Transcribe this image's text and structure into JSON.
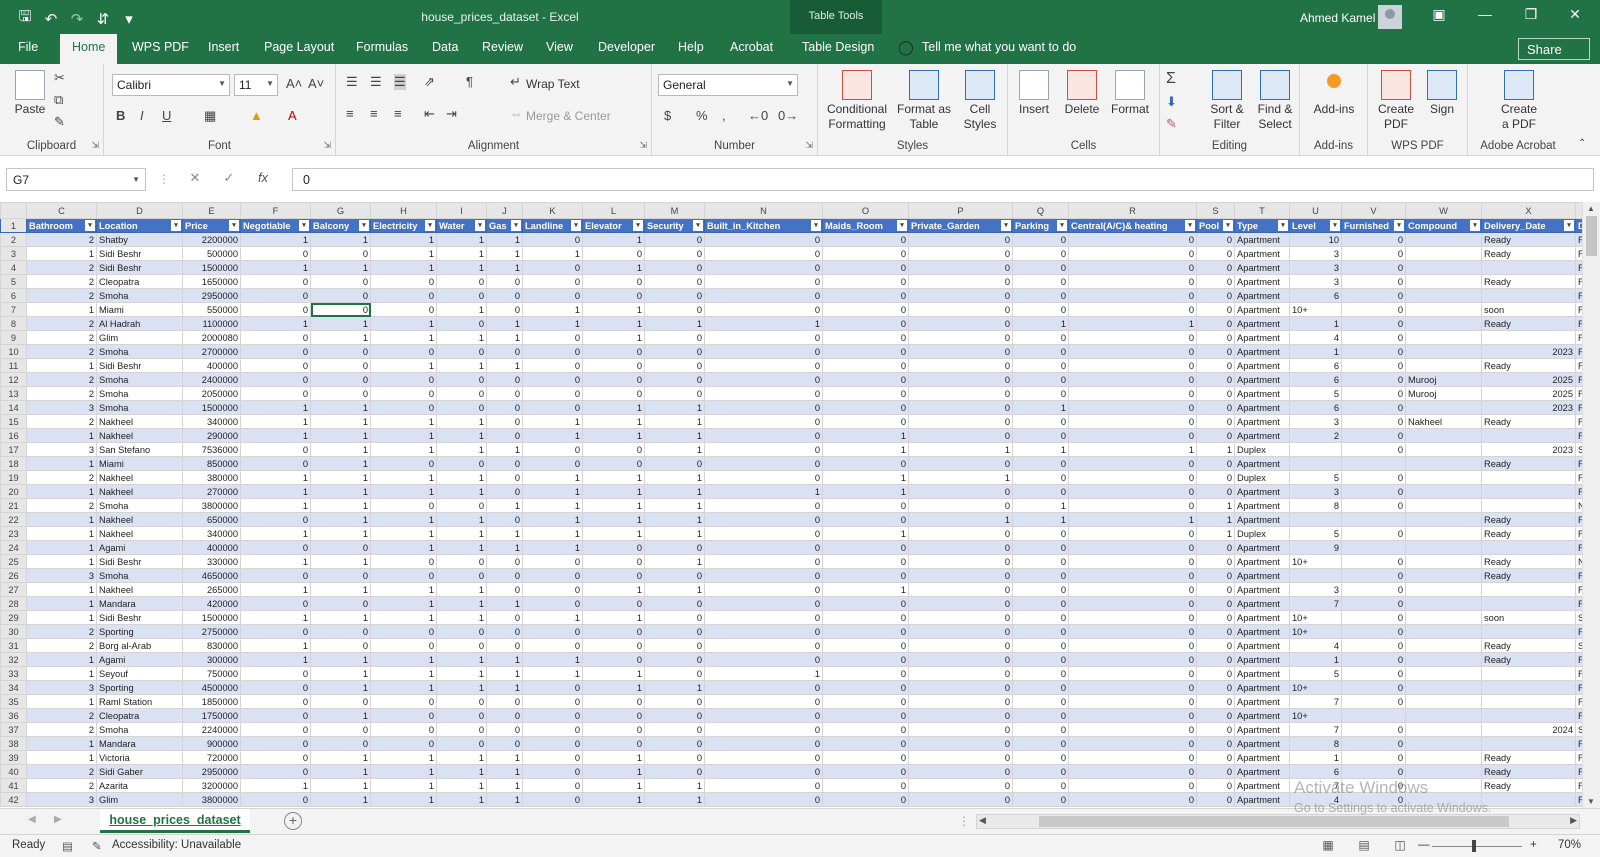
{
  "titlebar": {
    "doc_title": "house_prices_dataset  -  Excel",
    "context_group": "Table Tools",
    "user_name": "Ahmed Kamel",
    "qat_icons": [
      "save-icon",
      "undo-icon",
      "redo-icon",
      "sort-icon",
      "customize-icon"
    ]
  },
  "tabs": [
    "File",
    "Home",
    "WPS PDF",
    "Insert",
    "Page Layout",
    "Formulas",
    "Data",
    "Review",
    "View",
    "Developer",
    "Help",
    "Acrobat",
    "Table Design"
  ],
  "active_tab": "Home",
  "tell_me": "Tell me what you want to do",
  "share": "Share",
  "ribbon": {
    "clipboard": {
      "paste": "Paste",
      "label": "Clipboard"
    },
    "font": {
      "name": "Calibri",
      "size": "11",
      "bold": "B",
      "italic": "I",
      "underline": "U",
      "label": "Font"
    },
    "alignment": {
      "wrap_text": "Wrap Text",
      "merge_center": "Merge & Center",
      "label": "Alignment"
    },
    "number": {
      "format": "General",
      "label": "Number"
    },
    "styles": {
      "conditional": "Conditional",
      "conditional2": "Formatting",
      "format_as": "Format as",
      "format_as2": "Table",
      "cell": "Cell",
      "cell2": "Styles",
      "label": "Styles"
    },
    "cells": {
      "insert": "Insert",
      "delete": "Delete",
      "format": "Format",
      "label": "Cells"
    },
    "editing": {
      "sort": "Sort &",
      "sort2": "Filter",
      "find": "Find &",
      "find2": "Select",
      "label": "Editing"
    },
    "addins": {
      "addins": "Add-ins",
      "label": "Add-ins"
    },
    "wps": {
      "create": "Create",
      "create2": "PDF",
      "sign": "Sign",
      "label": "WPS PDF"
    },
    "acrobat": {
      "create": "Create",
      "create2": "a PDF",
      "label": "Adobe Acrobat"
    }
  },
  "formula_bar": {
    "name_box": "G7",
    "value": "0"
  },
  "columns": {
    "letters": [
      "C",
      "D",
      "E",
      "F",
      "G",
      "H",
      "I",
      "J",
      "K",
      "L",
      "M",
      "N",
      "O",
      "P",
      "Q",
      "R",
      "S",
      "T",
      "U",
      "V",
      "W",
      "X",
      "Y"
    ],
    "headers": [
      "Bathroom",
      "Location",
      "Price",
      "Negotiable",
      "Balcony",
      "Electricity",
      "Water",
      "Gas",
      "Landline",
      "Elevator",
      "Security",
      "Built_in_Kitchen",
      "Maids_Room",
      "Private_Garden",
      "Parking",
      "Central(A/C)& heating",
      "Pool",
      "Type",
      "Level",
      "Furnished",
      "Compound",
      "Delivery_Date",
      "Deli"
    ]
  },
  "rows": [
    [
      "2",
      "2",
      "Shatby",
      "2200000",
      "1",
      "1",
      "1",
      "1",
      "1",
      "0",
      "1",
      "0",
      "0",
      "0",
      "0",
      "0",
      "0",
      "0",
      "Apartment",
      "10",
      "0",
      "",
      "Ready",
      "Fini"
    ],
    [
      "3",
      "1",
      "Sidi Beshr",
      "500000",
      "0",
      "0",
      "1",
      "1",
      "1",
      "1",
      "0",
      "0",
      "0",
      "0",
      "0",
      "0",
      "0",
      "0",
      "Apartment",
      "3",
      "0",
      "",
      "Ready",
      "Fini"
    ],
    [
      "4",
      "2",
      "Sidi Beshr",
      "1500000",
      "1",
      "1",
      "1",
      "1",
      "1",
      "0",
      "1",
      "0",
      "0",
      "0",
      "0",
      "0",
      "0",
      "0",
      "Apartment",
      "3",
      "0",
      "",
      "",
      "Fini"
    ],
    [
      "5",
      "2",
      "Cleopatra",
      "1650000",
      "0",
      "0",
      "0",
      "0",
      "0",
      "0",
      "0",
      "0",
      "0",
      "0",
      "0",
      "0",
      "0",
      "0",
      "Apartment",
      "3",
      "0",
      "",
      "Ready",
      "Fini"
    ],
    [
      "6",
      "2",
      "Smoha",
      "2950000",
      "0",
      "0",
      "0",
      "0",
      "0",
      "0",
      "0",
      "0",
      "0",
      "0",
      "0",
      "0",
      "0",
      "0",
      "Apartment",
      "6",
      "0",
      "",
      "",
      "Fini"
    ],
    [
      "7",
      "1",
      "Miami",
      "550000",
      "0",
      "0",
      "0",
      "1",
      "0",
      "1",
      "1",
      "0",
      "0",
      "0",
      "0",
      "0",
      "0",
      "0",
      "Apartment",
      "10+",
      "0",
      "",
      "soon",
      "Fini"
    ],
    [
      "8",
      "2",
      "Al Hadrah",
      "1100000",
      "1",
      "1",
      "1",
      "0",
      "1",
      "1",
      "1",
      "1",
      "1",
      "0",
      "0",
      "1",
      "1",
      "0",
      "Apartment",
      "1",
      "0",
      "",
      "Ready",
      "Fini"
    ],
    [
      "9",
      "2",
      "Glim",
      "2000080",
      "0",
      "1",
      "1",
      "1",
      "1",
      "0",
      "1",
      "0",
      "0",
      "0",
      "0",
      "0",
      "0",
      "0",
      "Apartment",
      "4",
      "0",
      "",
      "",
      "Fini"
    ],
    [
      "10",
      "2",
      "Smoha",
      "2700000",
      "0",
      "0",
      "0",
      "0",
      "0",
      "0",
      "0",
      "0",
      "0",
      "0",
      "0",
      "0",
      "0",
      "0",
      "Apartment",
      "1",
      "0",
      "",
      "2023",
      "Fini"
    ],
    [
      "11",
      "1",
      "Sidi Beshr",
      "400000",
      "0",
      "0",
      "1",
      "1",
      "1",
      "0",
      "0",
      "0",
      "0",
      "0",
      "0",
      "0",
      "0",
      "0",
      "Apartment",
      "6",
      "0",
      "",
      "Ready",
      "Fini"
    ],
    [
      "12",
      "2",
      "Smoha",
      "2400000",
      "0",
      "0",
      "0",
      "0",
      "0",
      "0",
      "0",
      "0",
      "0",
      "0",
      "0",
      "0",
      "0",
      "0",
      "Apartment",
      "6",
      "0",
      "Murooj",
      "2025",
      "Fini"
    ],
    [
      "13",
      "2",
      "Smoha",
      "2050000",
      "0",
      "0",
      "0",
      "0",
      "0",
      "0",
      "0",
      "0",
      "0",
      "0",
      "0",
      "0",
      "0",
      "0",
      "Apartment",
      "5",
      "0",
      "Murooj",
      "2025",
      "Fini"
    ],
    [
      "14",
      "3",
      "Smoha",
      "1500000",
      "1",
      "1",
      "0",
      "0",
      "0",
      "0",
      "1",
      "1",
      "0",
      "0",
      "0",
      "1",
      "0",
      "0",
      "Apartment",
      "6",
      "0",
      "",
      "2023",
      "Fini"
    ],
    [
      "15",
      "2",
      "Nakheel",
      "340000",
      "1",
      "1",
      "1",
      "1",
      "0",
      "1",
      "1",
      "1",
      "0",
      "0",
      "0",
      "0",
      "0",
      "0",
      "Apartment",
      "3",
      "0",
      "Nakheel",
      "Ready",
      "Fini"
    ],
    [
      "16",
      "1",
      "Nakheel",
      "290000",
      "1",
      "1",
      "1",
      "1",
      "0",
      "1",
      "1",
      "1",
      "0",
      "1",
      "0",
      "0",
      "0",
      "0",
      "Apartment",
      "2",
      "0",
      "",
      "",
      "Fini"
    ],
    [
      "17",
      "3",
      "San Stefano",
      "7536000",
      "0",
      "1",
      "1",
      "1",
      "1",
      "0",
      "0",
      "1",
      "0",
      "1",
      "1",
      "1",
      "1",
      "1",
      "Duplex",
      "",
      "0",
      "",
      "2023",
      "Ser"
    ],
    [
      "18",
      "1",
      "Miami",
      "850000",
      "0",
      "1",
      "0",
      "0",
      "0",
      "0",
      "0",
      "0",
      "0",
      "0",
      "0",
      "0",
      "0",
      "0",
      "Apartment",
      "",
      "",
      "",
      "Ready",
      "Fini"
    ],
    [
      "19",
      "2",
      "Nakheel",
      "380000",
      "1",
      "1",
      "1",
      "1",
      "0",
      "1",
      "1",
      "1",
      "0",
      "1",
      "1",
      "0",
      "0",
      "0",
      "Duplex",
      "5",
      "0",
      "",
      "",
      "Fini"
    ],
    [
      "20",
      "1",
      "Nakheel",
      "270000",
      "1",
      "1",
      "1",
      "1",
      "0",
      "1",
      "1",
      "1",
      "1",
      "1",
      "0",
      "0",
      "0",
      "0",
      "Apartment",
      "3",
      "0",
      "",
      "",
      "Fini"
    ],
    [
      "21",
      "2",
      "Smoha",
      "3800000",
      "1",
      "1",
      "0",
      "0",
      "1",
      "1",
      "1",
      "1",
      "0",
      "0",
      "0",
      "1",
      "0",
      "1",
      "Apartment",
      "8",
      "0",
      "",
      "",
      "Not"
    ],
    [
      "22",
      "1",
      "Nakheel",
      "650000",
      "0",
      "1",
      "1",
      "1",
      "0",
      "1",
      "1",
      "1",
      "0",
      "0",
      "1",
      "1",
      "1",
      "1",
      "Apartment",
      "",
      "",
      "",
      "Ready",
      "Fini"
    ],
    [
      "23",
      "1",
      "Nakheel",
      "340000",
      "1",
      "1",
      "1",
      "1",
      "1",
      "1",
      "1",
      "1",
      "0",
      "1",
      "0",
      "0",
      "0",
      "1",
      "Duplex",
      "5",
      "0",
      "",
      "Ready",
      "Fini"
    ],
    [
      "24",
      "1",
      "Agami",
      "400000",
      "0",
      "0",
      "1",
      "1",
      "1",
      "1",
      "0",
      "0",
      "0",
      "0",
      "0",
      "0",
      "0",
      "0",
      "Apartment",
      "9",
      "",
      "",
      "",
      "Fini"
    ],
    [
      "25",
      "1",
      "Sidi Beshr",
      "330000",
      "1",
      "1",
      "0",
      "0",
      "0",
      "0",
      "0",
      "1",
      "0",
      "0",
      "0",
      "0",
      "0",
      "0",
      "Apartment",
      "10+",
      "0",
      "",
      "Ready",
      "Not"
    ],
    [
      "26",
      "3",
      "Smoha",
      "4650000",
      "0",
      "0",
      "0",
      "0",
      "0",
      "0",
      "0",
      "0",
      "0",
      "0",
      "0",
      "0",
      "0",
      "0",
      "Apartment",
      "",
      "0",
      "",
      "Ready",
      "Fini"
    ],
    [
      "27",
      "1",
      "Nakheel",
      "265000",
      "1",
      "1",
      "1",
      "1",
      "0",
      "0",
      "1",
      "1",
      "0",
      "1",
      "0",
      "0",
      "0",
      "0",
      "Apartment",
      "3",
      "0",
      "",
      "",
      "Fini"
    ],
    [
      "28",
      "1",
      "Mandara",
      "420000",
      "0",
      "0",
      "1",
      "1",
      "1",
      "0",
      "0",
      "0",
      "0",
      "0",
      "0",
      "0",
      "0",
      "0",
      "Apartment",
      "7",
      "0",
      "",
      "",
      "Fini"
    ],
    [
      "29",
      "1",
      "Sidi Beshr",
      "1500000",
      "1",
      "1",
      "1",
      "1",
      "0",
      "1",
      "1",
      "0",
      "0",
      "0",
      "0",
      "0",
      "0",
      "0",
      "Apartment",
      "10+",
      "0",
      "",
      "soon",
      "Ser"
    ],
    [
      "30",
      "2",
      "Sporting",
      "2750000",
      "0",
      "0",
      "0",
      "0",
      "0",
      "0",
      "0",
      "0",
      "0",
      "0",
      "0",
      "0",
      "0",
      "0",
      "Apartment",
      "10+",
      "0",
      "",
      "",
      "Fini"
    ],
    [
      "31",
      "2",
      "Borg al-Arab",
      "830000",
      "1",
      "0",
      "0",
      "0",
      "0",
      "0",
      "0",
      "0",
      "0",
      "0",
      "0",
      "0",
      "0",
      "0",
      "Apartment",
      "4",
      "0",
      "",
      "Ready",
      "Ser"
    ],
    [
      "32",
      "1",
      "Agami",
      "300000",
      "1",
      "1",
      "1",
      "1",
      "1",
      "1",
      "0",
      "0",
      "0",
      "0",
      "0",
      "0",
      "0",
      "0",
      "Apartment",
      "1",
      "0",
      "",
      "Ready",
      "Fini"
    ],
    [
      "33",
      "1",
      "Seyouf",
      "750000",
      "0",
      "1",
      "1",
      "1",
      "1",
      "1",
      "1",
      "0",
      "1",
      "0",
      "0",
      "0",
      "0",
      "0",
      "Apartment",
      "5",
      "0",
      "",
      "",
      "Fini"
    ],
    [
      "34",
      "3",
      "Sporting",
      "4500000",
      "0",
      "1",
      "1",
      "1",
      "1",
      "0",
      "1",
      "1",
      "0",
      "0",
      "0",
      "0",
      "0",
      "0",
      "Apartment",
      "10+",
      "0",
      "",
      "",
      "Fini"
    ],
    [
      "35",
      "1",
      "Raml Station",
      "1850000",
      "0",
      "0",
      "0",
      "0",
      "0",
      "0",
      "0",
      "0",
      "0",
      "0",
      "0",
      "0",
      "0",
      "0",
      "Apartment",
      "7",
      "0",
      "",
      "",
      "Fini"
    ],
    [
      "36",
      "2",
      "Cleopatra",
      "1750000",
      "0",
      "1",
      "0",
      "0",
      "0",
      "0",
      "0",
      "0",
      "0",
      "0",
      "0",
      "0",
      "0",
      "0",
      "Apartment",
      "10+",
      "",
      "",
      "",
      "Fini"
    ],
    [
      "37",
      "2",
      "Smoha",
      "2240000",
      "0",
      "0",
      "0",
      "0",
      "0",
      "0",
      "0",
      "0",
      "0",
      "0",
      "0",
      "0",
      "0",
      "0",
      "Apartment",
      "7",
      "0",
      "",
      "2024",
      "Ser"
    ],
    [
      "38",
      "1",
      "Mandara",
      "900000",
      "0",
      "0",
      "0",
      "0",
      "0",
      "0",
      "0",
      "0",
      "0",
      "0",
      "0",
      "0",
      "0",
      "0",
      "Apartment",
      "8",
      "0",
      "",
      "",
      "Fini"
    ],
    [
      "39",
      "1",
      "Victoria",
      "720000",
      "0",
      "1",
      "1",
      "1",
      "1",
      "0",
      "1",
      "0",
      "0",
      "0",
      "0",
      "0",
      "0",
      "0",
      "Apartment",
      "1",
      "0",
      "",
      "Ready",
      "Fini"
    ],
    [
      "40",
      "2",
      "Sidi Gaber",
      "2950000",
      "0",
      "1",
      "1",
      "1",
      "1",
      "0",
      "1",
      "0",
      "0",
      "0",
      "0",
      "0",
      "0",
      "0",
      "Apartment",
      "6",
      "0",
      "",
      "Ready",
      "Fini"
    ],
    [
      "41",
      "2",
      "Azarita",
      "3200000",
      "1",
      "1",
      "1",
      "1",
      "1",
      "0",
      "1",
      "1",
      "0",
      "0",
      "0",
      "0",
      "0",
      "0",
      "Apartment",
      "7",
      "0",
      "",
      "Ready",
      "Fini"
    ],
    [
      "42",
      "3",
      "Glim",
      "3800000",
      "0",
      "1",
      "1",
      "1",
      "1",
      "0",
      "1",
      "1",
      "0",
      "0",
      "0",
      "0",
      "0",
      "0",
      "Apartment",
      "4",
      "0",
      "",
      "",
      "Fini"
    ]
  ],
  "sheet": {
    "tab_name": "house_prices_dataset"
  },
  "watermark": {
    "line1": "Activate Windows",
    "line2": "Go to Settings to activate Windows."
  },
  "status": {
    "ready": "Ready",
    "accessibility": "Accessibility: Unavailable",
    "zoom": "70%"
  }
}
